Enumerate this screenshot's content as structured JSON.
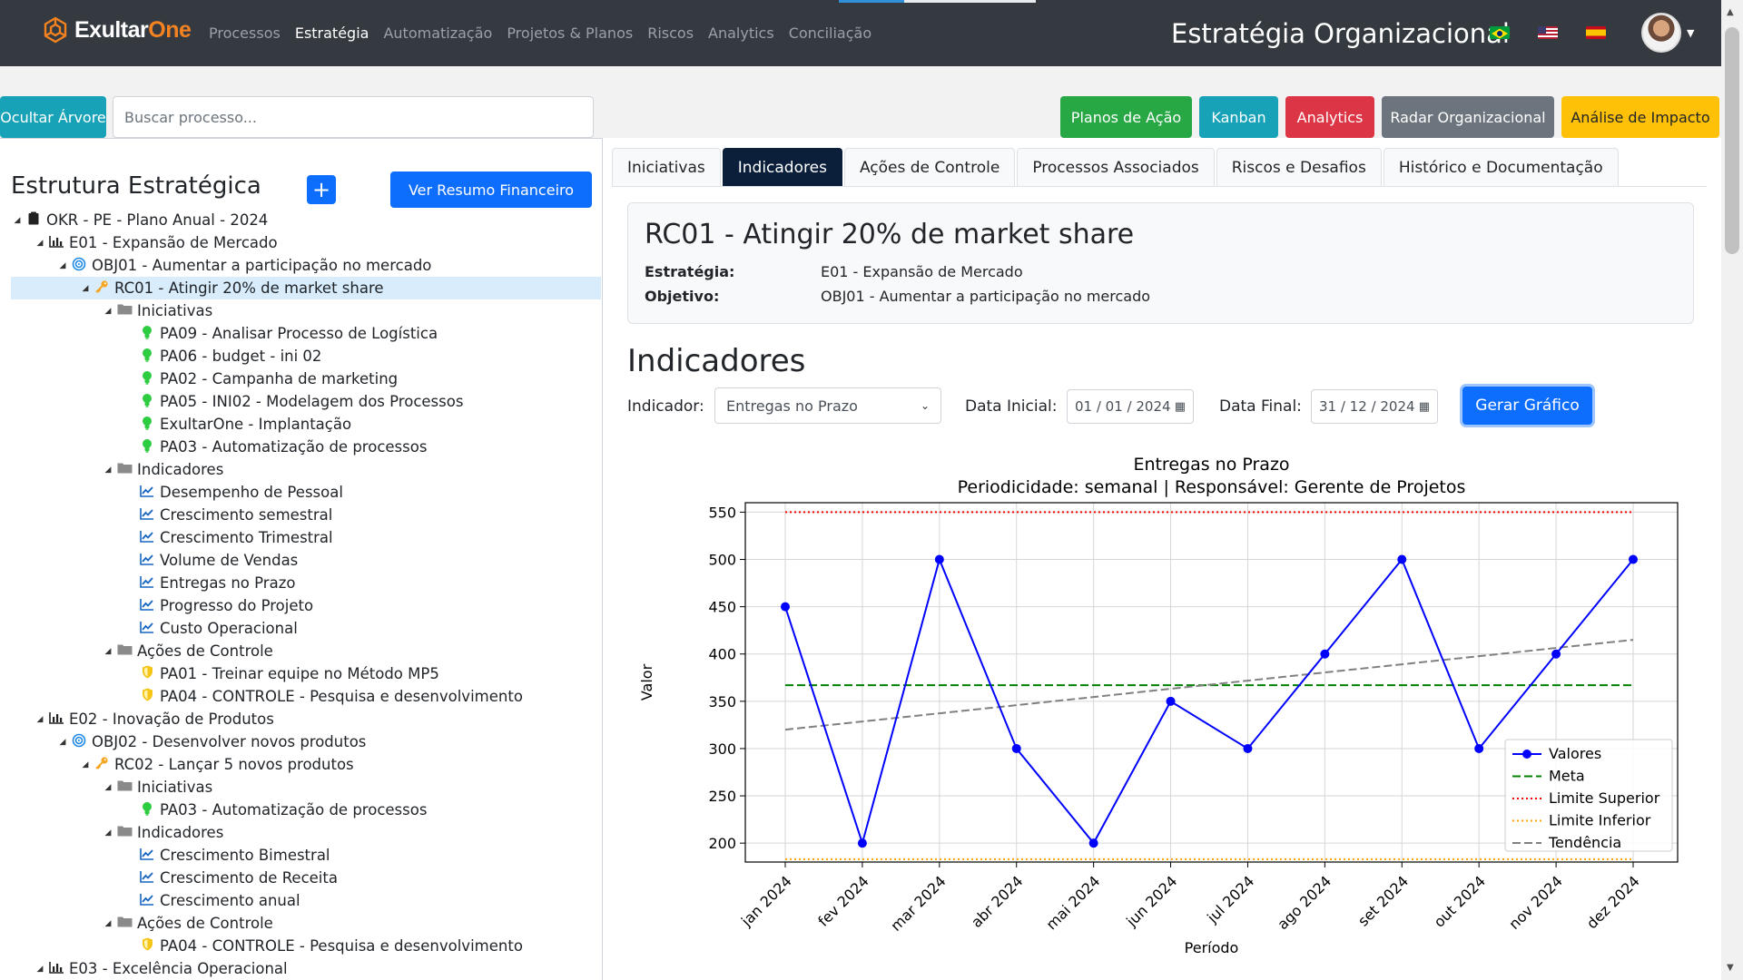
{
  "brand": {
    "name_part1": "Exultar",
    "name_part2": "One",
    "accent": "#f58220"
  },
  "nav": {
    "items": [
      {
        "label": "Processos",
        "active": false
      },
      {
        "label": "Estratégia",
        "active": true
      },
      {
        "label": "Automatização",
        "active": false
      },
      {
        "label": "Projetos & Planos",
        "active": false
      },
      {
        "label": "Riscos",
        "active": false
      },
      {
        "label": "Analytics",
        "active": false
      },
      {
        "label": "Conciliação",
        "active": false
      }
    ],
    "page_heading": "Estratégia Organizacional",
    "languages": [
      "flag-brazil-icon",
      "flag-usa-icon",
      "flag-spain-icon"
    ]
  },
  "toolbar": {
    "hide_tree_label": "Ocultar Árvore",
    "search_placeholder": "Buscar processo...",
    "buttons": [
      {
        "label": "Planos de Ação",
        "color": "#28a745"
      },
      {
        "label": "Kanban",
        "color": "#17a2b8"
      },
      {
        "label": "Analytics",
        "color": "#dc3545"
      },
      {
        "label": "Radar Organizacional",
        "color": "#6c757d"
      },
      {
        "label": "Análise de Impacto",
        "color": "#ffc107"
      }
    ]
  },
  "tree": {
    "title": "Estrutura Estratégica",
    "add_label": "+",
    "financial_label": "Ver Resumo Financeiro",
    "nodes": [
      {
        "level": 0,
        "icon": "clipboard-icon",
        "label": "OKR - PE - Plano Anual - 2024"
      },
      {
        "level": 1,
        "icon": "bar-chart-icon",
        "label": "E01 - Expansão de Mercado"
      },
      {
        "level": 2,
        "icon": "target-icon",
        "label": "OBJ01 - Aumentar a participação no mercado"
      },
      {
        "level": 3,
        "icon": "key-icon",
        "label": "RC01 - Atingir 20% de market share",
        "selected": true
      },
      {
        "level": 4,
        "icon": "folder-icon",
        "label": "Iniciativas"
      },
      {
        "level": 5,
        "icon": "lightbulb-icon",
        "label": "PA09 - Analisar Processo de Logística"
      },
      {
        "level": 5,
        "icon": "lightbulb-icon",
        "label": "PA06 - budget - ini 02"
      },
      {
        "level": 5,
        "icon": "lightbulb-icon",
        "label": "PA02 - Campanha de marketing"
      },
      {
        "level": 5,
        "icon": "lightbulb-icon",
        "label": "PA05 - INI02 - Modelagem dos Processos"
      },
      {
        "level": 5,
        "icon": "lightbulb-icon",
        "label": "ExultarOne - Implantação"
      },
      {
        "level": 5,
        "icon": "lightbulb-icon",
        "label": "PA03 - Automatização de processos"
      },
      {
        "level": 4,
        "icon": "folder-icon",
        "label": "Indicadores"
      },
      {
        "level": 5,
        "icon": "line-chart-icon",
        "label": "Desempenho de Pessoal"
      },
      {
        "level": 5,
        "icon": "line-chart-icon",
        "label": "Crescimento semestral"
      },
      {
        "level": 5,
        "icon": "line-chart-icon",
        "label": "Crescimento Trimestral"
      },
      {
        "level": 5,
        "icon": "line-chart-icon",
        "label": "Volume de Vendas"
      },
      {
        "level": 5,
        "icon": "line-chart-icon",
        "label": "Entregas no Prazo"
      },
      {
        "level": 5,
        "icon": "line-chart-icon",
        "label": "Progresso do Projeto"
      },
      {
        "level": 5,
        "icon": "line-chart-icon",
        "label": "Custo Operacional"
      },
      {
        "level": 4,
        "icon": "folder-icon",
        "label": "Ações de Controle"
      },
      {
        "level": 5,
        "icon": "shield-icon",
        "label": "PA01 - Treinar equipe no Método MP5"
      },
      {
        "level": 5,
        "icon": "shield-icon",
        "label": "PA04 - CONTROLE - Pesquisa e desenvolvimento"
      },
      {
        "level": 1,
        "icon": "bar-chart-icon",
        "label": "E02 - Inovação de Produtos"
      },
      {
        "level": 2,
        "icon": "target-icon",
        "label": "OBJ02 - Desenvolver novos produtos"
      },
      {
        "level": 3,
        "icon": "key-icon",
        "label": "RC02 - Lançar 5 novos produtos"
      },
      {
        "level": 4,
        "icon": "folder-icon",
        "label": "Iniciativas"
      },
      {
        "level": 5,
        "icon": "lightbulb-icon",
        "label": "PA03 - Automatização de processos"
      },
      {
        "level": 4,
        "icon": "folder-icon",
        "label": "Indicadores"
      },
      {
        "level": 5,
        "icon": "line-chart-icon",
        "label": "Crescimento Bimestral"
      },
      {
        "level": 5,
        "icon": "line-chart-icon",
        "label": "Crescimento de Receita"
      },
      {
        "level": 5,
        "icon": "line-chart-icon",
        "label": "Crescimento anual"
      },
      {
        "level": 4,
        "icon": "folder-icon",
        "label": "Ações de Controle"
      },
      {
        "level": 5,
        "icon": "shield-icon",
        "label": "PA04 - CONTROLE - Pesquisa e desenvolvimento"
      },
      {
        "level": 1,
        "icon": "bar-chart-icon",
        "label": "E03 - Excelência Operacional"
      }
    ]
  },
  "tabs": [
    {
      "label": "Iniciativas",
      "active": false
    },
    {
      "label": "Indicadores",
      "active": true
    },
    {
      "label": "Ações de Controle",
      "active": false
    },
    {
      "label": "Processos Associados",
      "active": false
    },
    {
      "label": "Riscos e Desafios",
      "active": false
    },
    {
      "label": "Histórico e Documentação",
      "active": false
    }
  ],
  "detail": {
    "title": "RC01 - Atingir 20% de market share",
    "strategy_label": "Estratégia:",
    "strategy_value": "E01 - Expansão de Mercado",
    "objective_label": "Objetivo:",
    "objective_value": "OBJ01 - Aumentar a participação no mercado"
  },
  "indicators": {
    "section_title": "Indicadores",
    "indicator_label": "Indicador:",
    "indicator_value": "Entregas no Prazo",
    "start_label": "Data Inicial:",
    "start_value": "01 / 01 / 2024",
    "end_label": "Data Final:",
    "end_value": "31 / 12 / 2024",
    "generate_label": "Gerar Gráfico"
  },
  "chart_data": {
    "type": "line",
    "title": "Entregas no Prazo",
    "subtitle": "Periodicidade: semanal | Responsável: Gerente de Projetos",
    "xlabel": "Período",
    "ylabel": "Valor",
    "categories": [
      "jan 2024",
      "fev 2024",
      "mar 2024",
      "abr 2024",
      "mai 2024",
      "jun 2024",
      "jul 2024",
      "ago 2024",
      "set 2024",
      "out 2024",
      "nov 2024",
      "dez 2024"
    ],
    "ylim": [
      180,
      560
    ],
    "yticks": [
      200,
      250,
      300,
      350,
      400,
      450,
      500,
      550
    ],
    "grid": true,
    "legend_position": "bottom-right",
    "series": [
      {
        "name": "Valores",
        "style": "line-markers",
        "color": "#0000ff",
        "values": [
          450,
          200,
          500,
          300,
          200,
          350,
          300,
          400,
          500,
          300,
          400,
          500
        ]
      },
      {
        "name": "Meta",
        "style": "dashed",
        "color": "#008000",
        "values": [
          367,
          367,
          367,
          367,
          367,
          367,
          367,
          367,
          367,
          367,
          367,
          367
        ]
      },
      {
        "name": "Limite Superior",
        "style": "dotted",
        "color": "#ff0000",
        "values": [
          550,
          550,
          550,
          550,
          550,
          550,
          550,
          550,
          550,
          550,
          550,
          550
        ]
      },
      {
        "name": "Limite Inferior",
        "style": "dotted",
        "color": "#ffa500",
        "values": [
          183,
          183,
          183,
          183,
          183,
          183,
          183,
          183,
          183,
          183,
          183,
          183
        ]
      },
      {
        "name": "Tendência",
        "style": "dashed",
        "color": "#808080",
        "values": [
          320,
          328.6,
          337.3,
          345.9,
          354.5,
          363.2,
          371.8,
          380.5,
          389.1,
          397.7,
          406.4,
          415
        ]
      }
    ]
  }
}
